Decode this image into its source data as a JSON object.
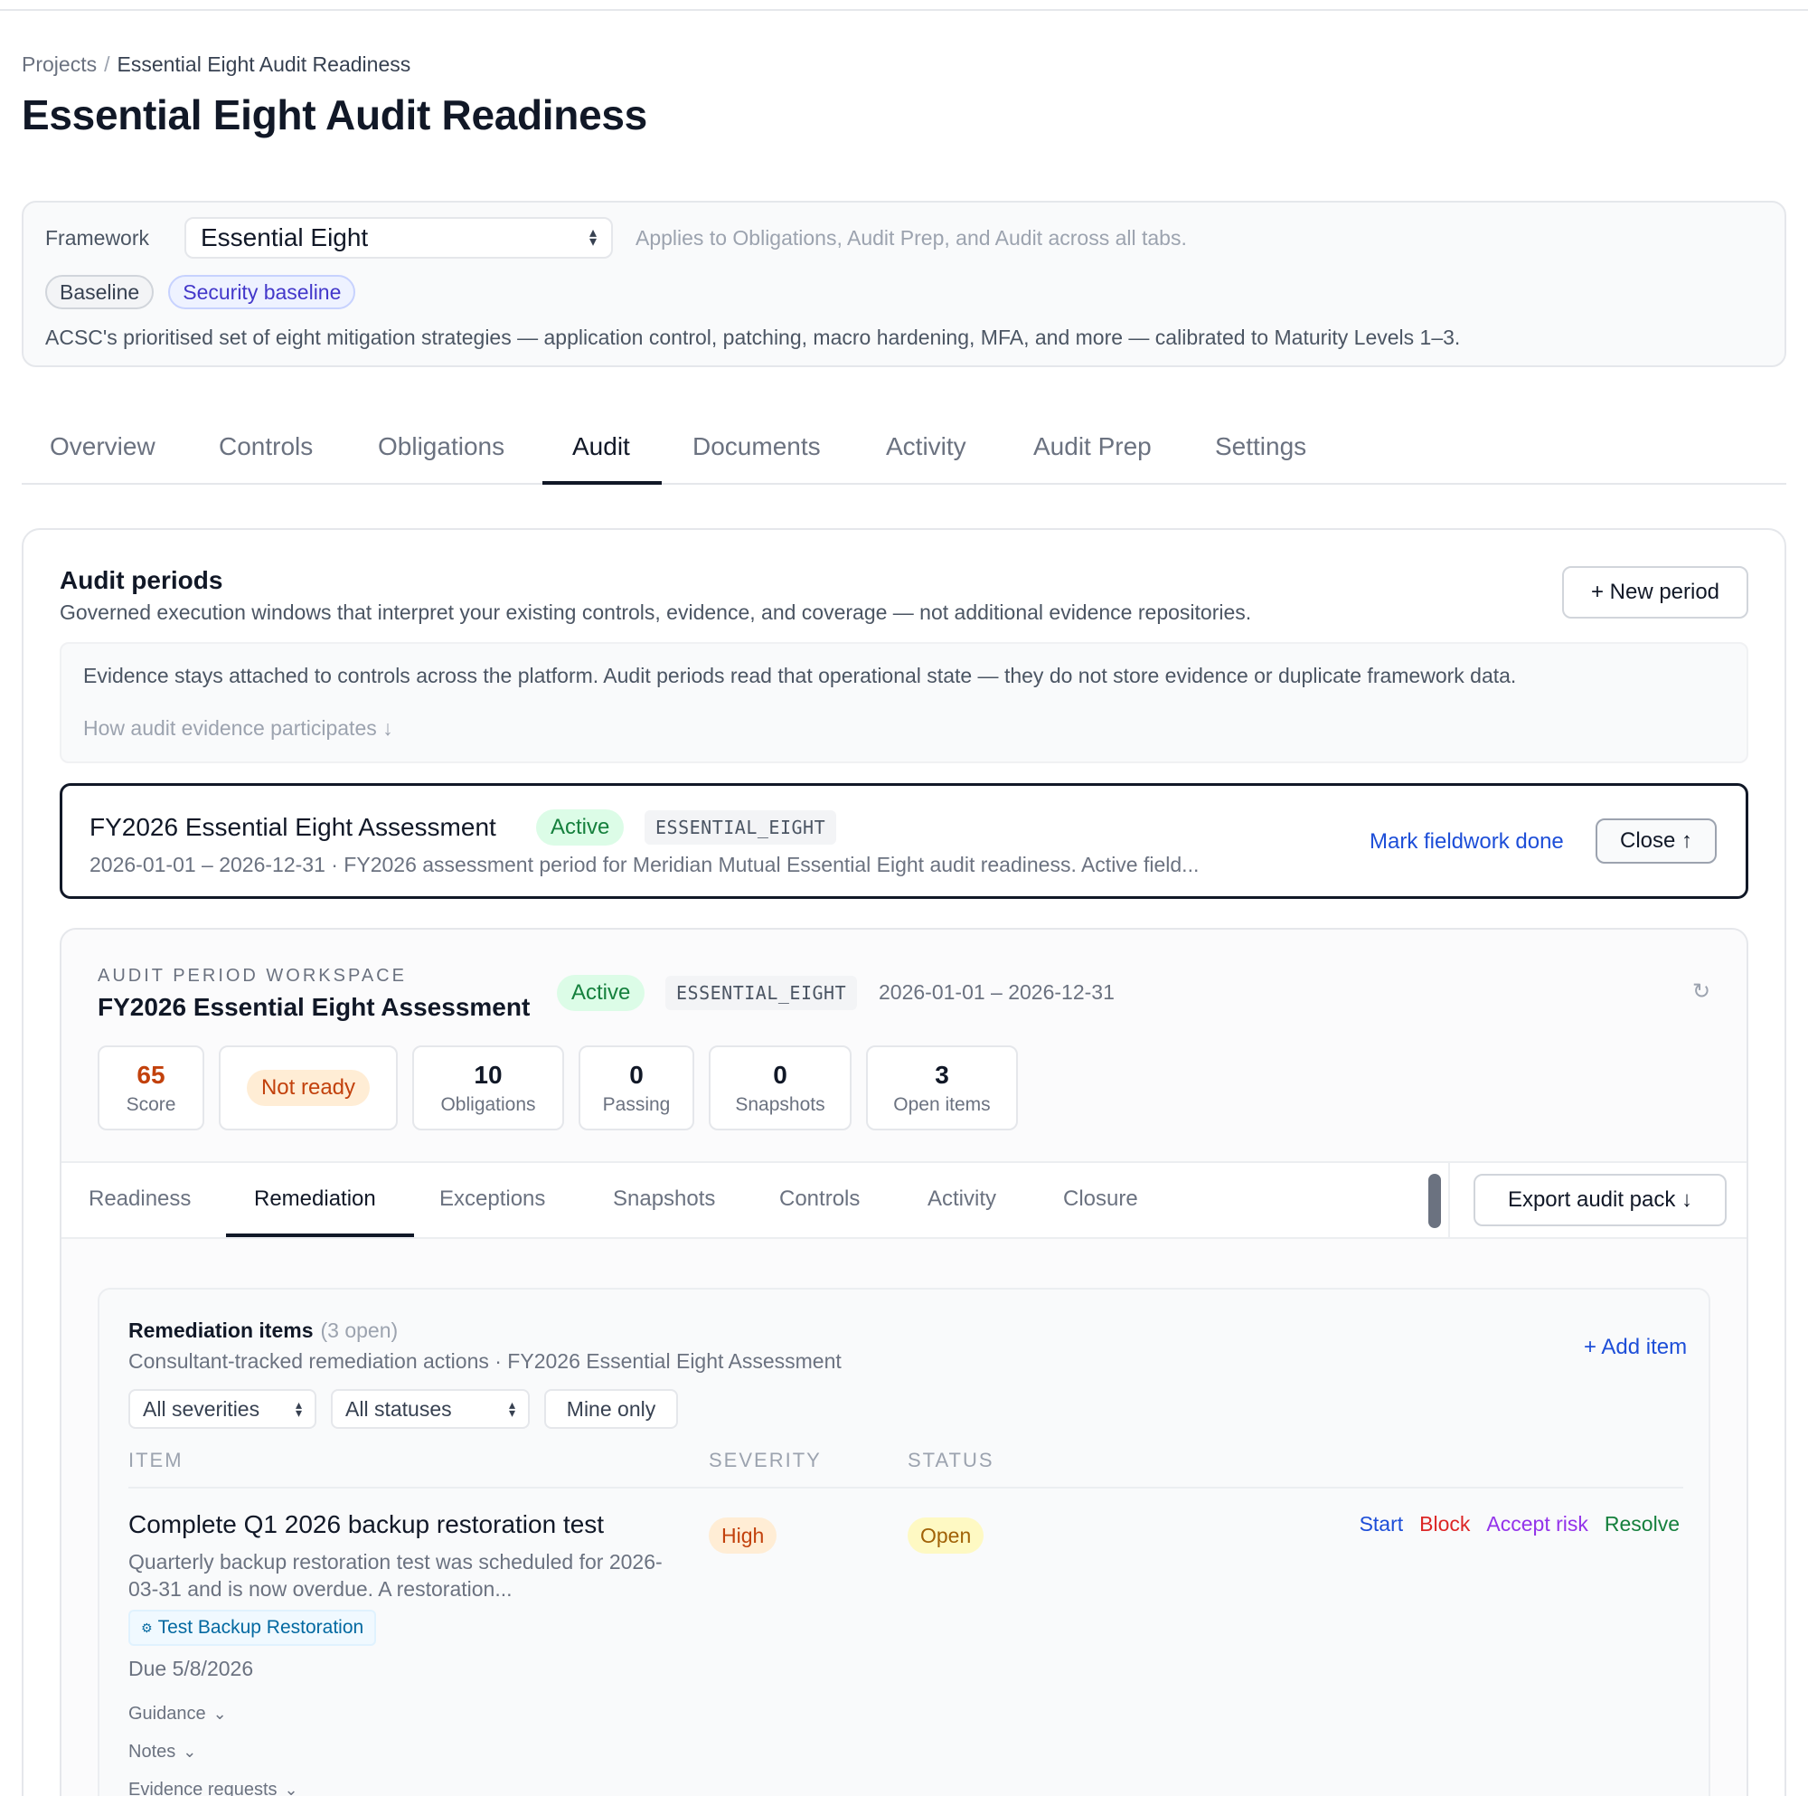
{
  "breadcrumb": {
    "parent": "Projects",
    "separator": "/",
    "current": "Essential Eight Audit Readiness"
  },
  "page_title": "Essential Eight Audit Readiness",
  "framework": {
    "label": "Framework",
    "selected": "Essential Eight",
    "hint": "Applies to Obligations, Audit Prep, and Audit across all tabs.",
    "badges": [
      "Baseline",
      "Security baseline"
    ],
    "description": "ACSC's prioritised set of eight mitigation strategies — application control, patching, macro hardening, MFA, and more — calibrated to Maturity Levels 1–3."
  },
  "tabs": [
    "Overview",
    "Controls",
    "Obligations",
    "Audit",
    "Documents",
    "Activity",
    "Audit Prep",
    "Settings"
  ],
  "active_tab": "Audit",
  "audit_periods": {
    "title": "Audit periods",
    "subtitle": "Governed execution windows that interpret your existing controls, evidence, and coverage — not additional evidence repositories.",
    "new_period_label": "+ New period",
    "info_text": "Evidence stays attached to controls across the platform. Audit periods read that operational state — they do not store evidence or duplicate framework data.",
    "info_link": "How audit evidence participates ↓"
  },
  "period": {
    "title": "FY2026 Essential Eight Assessment",
    "status": "Active",
    "code": "ESSENTIAL_EIGHT",
    "summary": "2026-01-01 – 2026-12-31 · FY2026 assessment period for Meridian Mutual Essential Eight audit readiness. Active field...",
    "mark_done_label": "Mark fieldwork done",
    "close_label": "Close ↑"
  },
  "workspace": {
    "kicker": "AUDIT PERIOD WORKSPACE",
    "title": "FY2026 Essential Eight Assessment",
    "status": "Active",
    "code": "ESSENTIAL_EIGHT",
    "dates": "2026-01-01 – 2026-12-31",
    "refresh_icon": "↻",
    "stats": {
      "score": {
        "value": "65",
        "label": "Score"
      },
      "readiness": "Not ready",
      "obligations": {
        "value": "10",
        "label": "Obligations"
      },
      "passing": {
        "value": "0",
        "label": "Passing"
      },
      "snapshots": {
        "value": "0",
        "label": "Snapshots"
      },
      "open_items": {
        "value": "3",
        "label": "Open items"
      }
    },
    "subtabs": [
      "Readiness",
      "Remediation",
      "Exceptions",
      "Snapshots",
      "Controls",
      "Activity",
      "Closure"
    ],
    "active_subtab": "Remediation",
    "export_label": "Export audit pack ↓"
  },
  "remediation": {
    "title": "Remediation items",
    "count": "(3 open)",
    "subtitle": "Consultant-tracked remediation actions · FY2026 Essential Eight Assessment",
    "add_label": "+ Add item",
    "filters": {
      "severity": "All severities",
      "status": "All statuses",
      "mine": "Mine only"
    },
    "columns": {
      "item": "ITEM",
      "severity": "SEVERITY",
      "status": "STATUS"
    },
    "items": [
      {
        "title": "Complete Q1 2026 backup restoration test",
        "description": "Quarterly backup restoration test was scheduled for 2026-03-31 and is now overdue. A restoration...",
        "control": "Test Backup Restoration",
        "due": "Due 5/8/2026",
        "severity": "High",
        "status": "Open",
        "actions": {
          "start": "Start",
          "block": "Block",
          "accept": "Accept risk",
          "resolve": "Resolve"
        },
        "expanders": {
          "guidance": "Guidance",
          "notes": "Notes",
          "evidence": "Evidence requests"
        }
      }
    ]
  },
  "colors": {
    "accent": "#111827",
    "link": "#1d4ed8",
    "success": "#15803d",
    "warning": "#c2410c"
  }
}
